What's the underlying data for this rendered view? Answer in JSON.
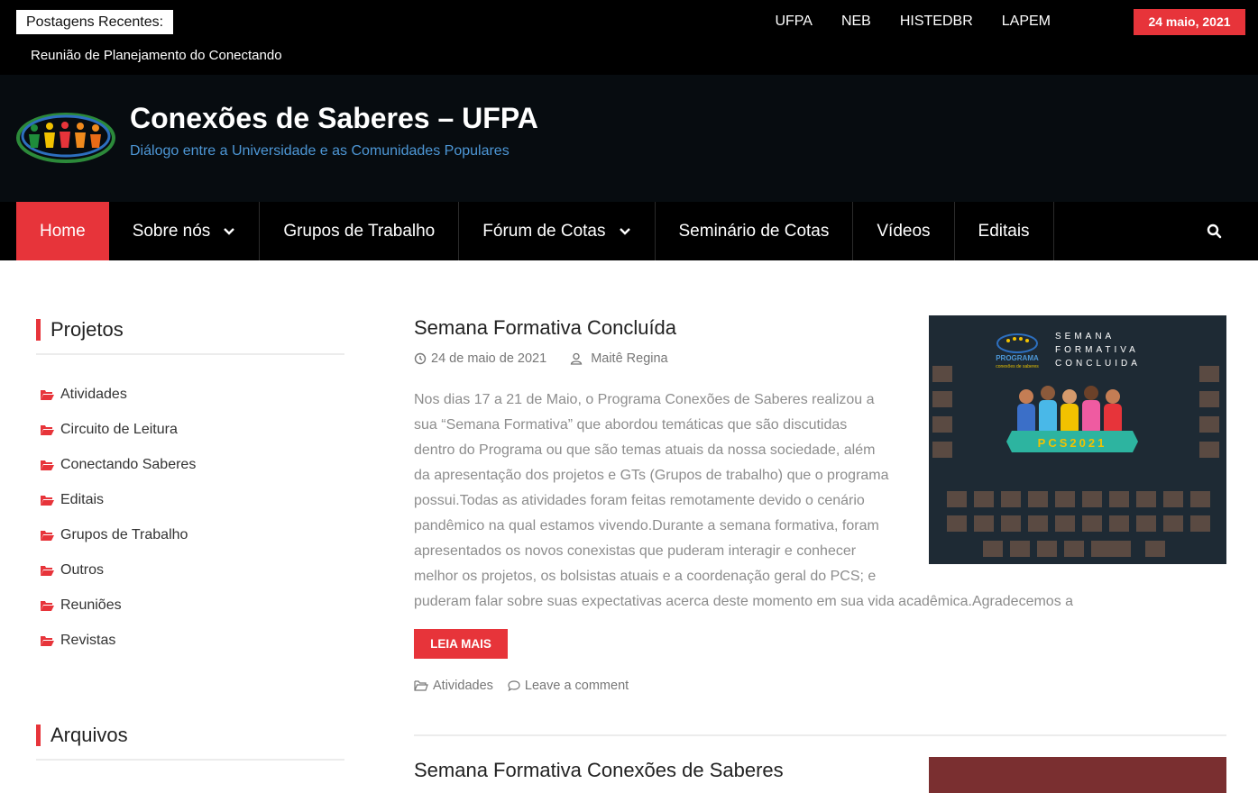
{
  "topbar": {
    "recent_label": "Postagens Recentes:",
    "recent_post": "Reunião de Planejamento do Conectando",
    "links": [
      "UFPA",
      "NEB",
      "HISTEDBR",
      "LAPEM"
    ],
    "date": "24 maio, 2021"
  },
  "header": {
    "title": "Conexões de Saberes – UFPA",
    "description": "Diálogo entre a Universidade e as Comunidades Populares"
  },
  "nav": {
    "items": [
      "Home",
      "Sobre nós",
      "Grupos de Trabalho",
      "Fórum de Cotas",
      "Seminário de Cotas",
      "Vídeos",
      "Editais"
    ]
  },
  "sidebar": {
    "projects_title": "Projetos",
    "categories": [
      "Atividades",
      "Circuito de Leitura",
      "Conectando Saberes",
      "Editais",
      "Grupos de Trabalho",
      "Outros",
      "Reuniões",
      "Revistas"
    ],
    "archives_title": "Arquivos"
  },
  "post1": {
    "title": "Semana Formativa Concluída",
    "date": "24 de maio de 2021",
    "author": "Maitê Regina",
    "excerpt_lines": [
      "Nos dias 17 a 21 de Maio, o Programa Conexões de Saberes realizou a",
      "sua “Semana Formativa” que abordou temáticas que são discutidas",
      "dentro do Programa ou que são temas atuais da nossa sociedade, além",
      "da apresentação dos projetos e GTs (Grupos de trabalho) que o programa",
      "possui.Todas as atividades foram feitas remotamente devido o cenário",
      "pandêmico na qual estamos vivendo.Durante a semana formativa, foram",
      "apresentados os novos conexistas que puderam interagir e conhecer",
      "melhor os projetos, os bolsistas atuais e a coordenação geral do PCS; e",
      "puderam falar sobre suas expectativas acerca deste momento em sua vida acadêmica.Agradecemos a"
    ],
    "read_more": "LEIA MAIS",
    "category": "Atividades",
    "comment": "Leave a comment",
    "image_text": {
      "program": "PROGRAMA",
      "program_sub": "conexões de saberes",
      "line1": "SEMANA",
      "line2": "FORMATIVA",
      "line3": "CONCLUIDA",
      "banner": "PCS2021"
    }
  },
  "post2": {
    "title": "Semana Formativa Conexões de Saberes"
  },
  "colors": {
    "accent": "#e7343a",
    "header_bg": "#070c10",
    "link_blue": "#4d97d6"
  }
}
